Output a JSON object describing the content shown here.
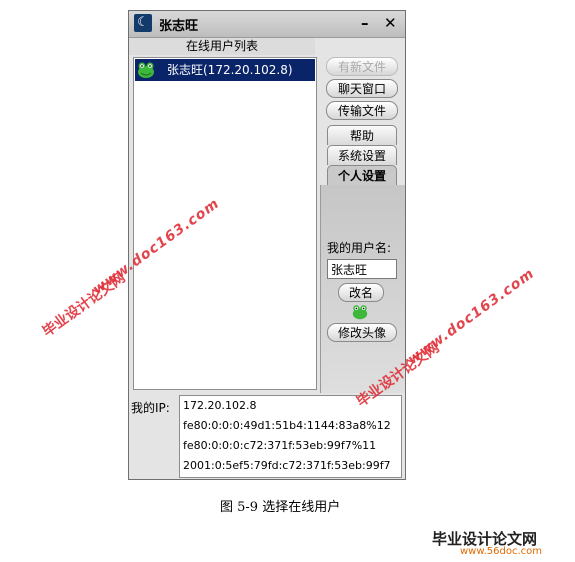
{
  "window": {
    "title": "张志旺",
    "minimize_label": "–",
    "close_label": "✕"
  },
  "user_list": {
    "header": "在线用户列表",
    "items": [
      {
        "label": "张志旺(172.20.102.8)"
      }
    ]
  },
  "buttons": {
    "new_file": "有新文件",
    "chat_window": "聊天窗口",
    "transfer_file": "传输文件"
  },
  "tabs": [
    "帮助",
    "系统设置",
    "个人设置"
  ],
  "personal": {
    "username_label": "我的用户名:",
    "username_value": "张志旺",
    "rename_label": "改名",
    "change_avatar_label": "修改头像"
  },
  "ip": {
    "label": "我的IP:",
    "addresses": [
      "172.20.102.8",
      "fe80:0:0:0:49d1:51b4:1144:83a8%12",
      "fe80:0:0:0:c72:371f:53eb:99f7%11",
      "2001:0:5ef5:79fd:c72:371f:53eb:99f7"
    ]
  },
  "caption": "图  5-9 选择在线用户",
  "watermarks": {
    "site_name": "毕业设计论文网",
    "url": "www.doc163.com",
    "logo_text": "毕业设计论文网",
    "logo_url": "www.56doc.com"
  }
}
